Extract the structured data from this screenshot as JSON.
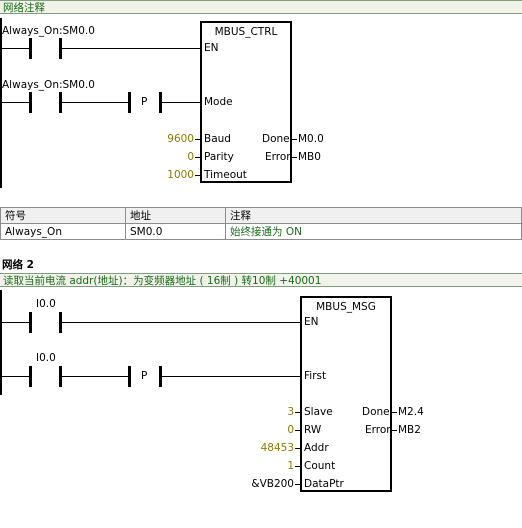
{
  "network1": {
    "comment": "网络注释",
    "contact1_label": "Always_On:SM0.0",
    "contact2_label": "Always_On:SM0.0",
    "p_label": "P",
    "block": {
      "title": "MBUS_CTRL",
      "in_pins": [
        "EN",
        "Mode",
        "Baud",
        "Parity",
        "Timeout"
      ],
      "out_pins": [
        "Done",
        "Error"
      ],
      "in_values": [
        "9600",
        "0",
        "1000"
      ],
      "out_values": [
        "M0.0",
        "MB0"
      ]
    }
  },
  "symbol_table": {
    "headers": [
      "符号",
      "地址",
      "注释"
    ],
    "row": [
      "Always_On",
      "SM0.0",
      "始终接通为 ON"
    ]
  },
  "network2": {
    "title": "网络 2",
    "comment": "读取当前电流      addr(地址)：为变频器地址 ( 16制 ) 转10制 +40001",
    "contact1_label": "I0.0",
    "contact2_label": "I0.0",
    "p_label": "P",
    "block": {
      "title": "MBUS_MSG",
      "in_pins": [
        "EN",
        "First",
        "Slave",
        "RW",
        "Addr",
        "Count",
        "DataPtr"
      ],
      "out_pins": [
        "Done",
        "Error"
      ],
      "in_values": [
        "3",
        "0",
        "48453",
        "1",
        "&VB200"
      ],
      "out_values": [
        "M2.4",
        "MB2"
      ]
    }
  }
}
